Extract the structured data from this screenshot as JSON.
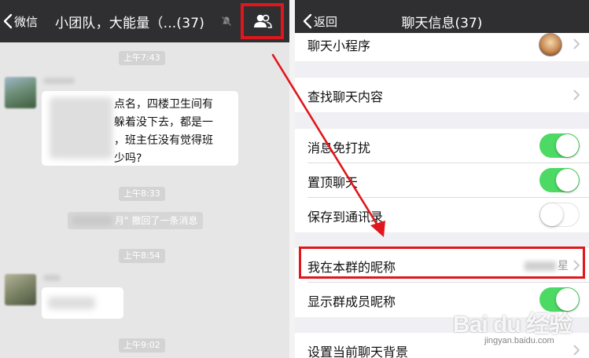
{
  "left_panel": {
    "nav": {
      "back_label": "微信",
      "title": "小团队，大能量（...(37)"
    },
    "messages": [
      {
        "type": "time",
        "text": "上午7:43"
      },
      {
        "type": "text",
        "visible_lines": [
          "点名，四楼卫生间有",
          "躲着没下去，都是一",
          "，班主任没有觉得班",
          "少吗?"
        ]
      },
      {
        "type": "time",
        "text": "上午8:33"
      },
      {
        "type": "system",
        "text": "月\" 撤回了一条消息"
      },
      {
        "type": "time",
        "text": "上午8:54"
      },
      {
        "type": "time",
        "text": "上午9:02"
      }
    ]
  },
  "right_panel": {
    "nav": {
      "back_label": "返回",
      "title": "聊天信息(37)"
    },
    "rows": {
      "mini_program": "聊天小程序",
      "search_history": "查找聊天内容",
      "mute": {
        "label": "消息免打扰",
        "on": true
      },
      "sticky": {
        "label": "置顶聊天",
        "on": true
      },
      "save_contacts": {
        "label": "保存到通讯录",
        "on": false
      },
      "my_nickname": {
        "label": "我在本群的昵称",
        "value_suffix": "星"
      },
      "show_nicknames": {
        "label": "显示群成员昵称",
        "on": true
      },
      "background": "设置当前聊天背景"
    }
  },
  "watermark": {
    "main": "Bai du 经验",
    "sub": "jingyan.baidu.com"
  },
  "colors": {
    "nav_bg": "#2f2f31",
    "toggle_on": "#4cd964",
    "highlight_red": "#e1161c",
    "chat_bg": "#e6e6e6",
    "settings_bg": "#efeff4"
  }
}
